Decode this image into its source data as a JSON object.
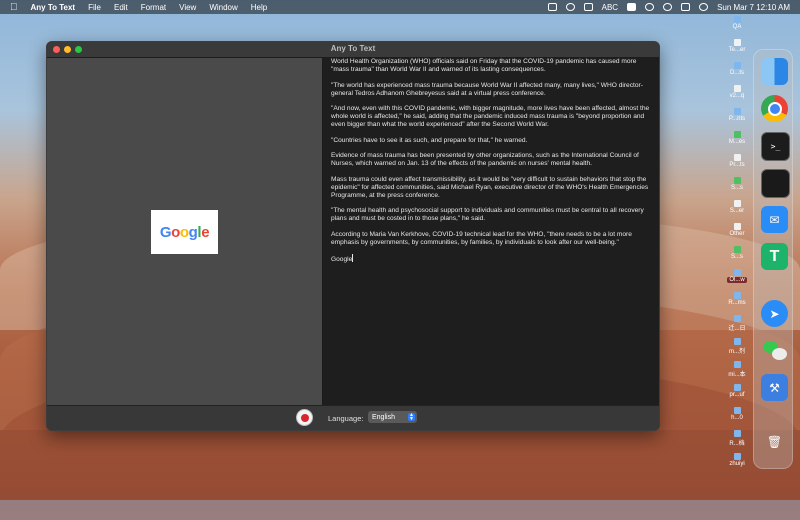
{
  "menubar": {
    "app_name": "Any To Text",
    "menus": [
      "File",
      "Edit",
      "Format",
      "View",
      "Window",
      "Help"
    ],
    "input_source": "ABC",
    "clock": "Sun Mar 7  12:10 AM"
  },
  "window": {
    "title": "Any To Text",
    "paragraphs": [
      "World Health Organization (WHO) officials said on Friday that the COVID-19 pandemic has caused more \"mass trauma\" than World War II and warned of its lasting consequences.",
      "\"The world has experienced mass trauma because World War II affected many, many lives,\" WHO director-general Tedros Adhanom Ghebreyesus said at a virtual press conference.",
      "\"And now, even with this COVID pandemic, with bigger magnitude, more lives have been affected, almost the whole world is affected,\" he said, adding that the pandemic induced mass trauma is \"beyond proportion and even bigger than what the world experienced\" after the Second World War.",
      "\"Countries have to see it as such, and prepare for that,\" he warned.",
      "Evidence of mass trauma has been presented by other organizations, such as the International Council of Nurses, which warned on Jan. 13 of the effects of the pandemic on nurses' mental health.",
      "Mass trauma could even affect transmissibility, as it would be \"very difficult to sustain behaviors that stop the epidemic\" for affected communities, said Michael Ryan, executive director of the WHO's Health Emergencies Programme, at the press conference.",
      "\"The mental health and psychosocial support to individuals and communities must be central to all recovery plans and must be costed in to those plans,\" he said.",
      "According to Maria Van Kerkhove, COVID-19 technical lead for the WHO, \"there needs to be a lot more emphasis by governments, by communities, by families, by individuals to look after our well-being.\"",
      "Google"
    ],
    "image_logo_letters": [
      "G",
      "o",
      "o",
      "g",
      "l",
      "e"
    ],
    "language_label": "Language:",
    "language_value": "English"
  },
  "desktop_icons": [
    {
      "label": "QA",
      "type": "folder"
    },
    {
      "label": "Te...er",
      "type": "doc"
    },
    {
      "label": "D...ts",
      "type": "folder"
    },
    {
      "label": "v2...q",
      "type": "doc"
    },
    {
      "label": "P...nts",
      "type": "folder"
    },
    {
      "label": "M...es",
      "type": "green"
    },
    {
      "label": "Pr...ts",
      "type": "doc"
    },
    {
      "label": "S...s",
      "type": "green"
    },
    {
      "label": "S...er",
      "type": "doc"
    },
    {
      "label": "Other",
      "type": "doc"
    },
    {
      "label": "S...s",
      "type": "green"
    },
    {
      "label": "Ol...w",
      "type": "folder",
      "selected": true
    },
    {
      "label": "R...ms",
      "type": "folder"
    },
    {
      "label": "迁...日",
      "type": "folder"
    },
    {
      "label": "m...剂",
      "type": "folder"
    },
    {
      "label": "mi...本",
      "type": "folder"
    },
    {
      "label": "pr...uf",
      "type": "folder"
    },
    {
      "label": "h...0",
      "type": "folder"
    },
    {
      "label": "R...档",
      "type": "folder"
    },
    {
      "label": "zhuiyi",
      "type": "folder"
    }
  ],
  "dock_items": [
    "finder-icon",
    "chrome-icon",
    "terminal-icon",
    "activity-monitor-icon",
    "mail-icon",
    "t-app-icon",
    "safari-icon",
    "wechat-icon",
    "xcode-icon",
    "trash-icon"
  ],
  "colors": {
    "record_red": "#d8262e",
    "select_blue": "#2f7cf6",
    "text_pane_bg": "#1e1e1e",
    "image_pane_bg": "#4a4a4a"
  }
}
